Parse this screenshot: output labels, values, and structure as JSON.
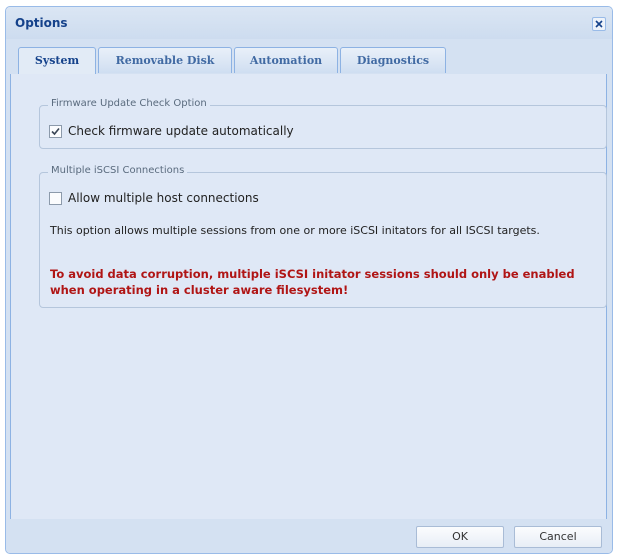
{
  "window": {
    "title": "Options",
    "close_icon": "close-icon"
  },
  "tabs": [
    {
      "label": "System",
      "active": true
    },
    {
      "label": "Removable Disk",
      "active": false
    },
    {
      "label": "Automation",
      "active": false
    },
    {
      "label": "Diagnostics",
      "active": false
    }
  ],
  "firmware": {
    "legend": "Firmware Update Check Option",
    "checkbox_label": "Check firmware update automatically",
    "checked": true
  },
  "iscsi": {
    "legend": "Multiple iSCSI Connections",
    "checkbox_label": "Allow multiple host connections",
    "checked": false,
    "description": "This option allows multiple sessions from one or more iSCSI initators for all ISCSI targets.",
    "warning": "To avoid data corruption, multiple iSCSI initator sessions should only be enabled when operating in a cluster aware filesystem!"
  },
  "buttons": {
    "ok": "OK",
    "cancel": "Cancel"
  },
  "colors": {
    "title_text": "#15428b",
    "warning_text": "#b01515",
    "panel_bg": "#dfe8f6",
    "frame_bg": "#d4e1f2"
  }
}
